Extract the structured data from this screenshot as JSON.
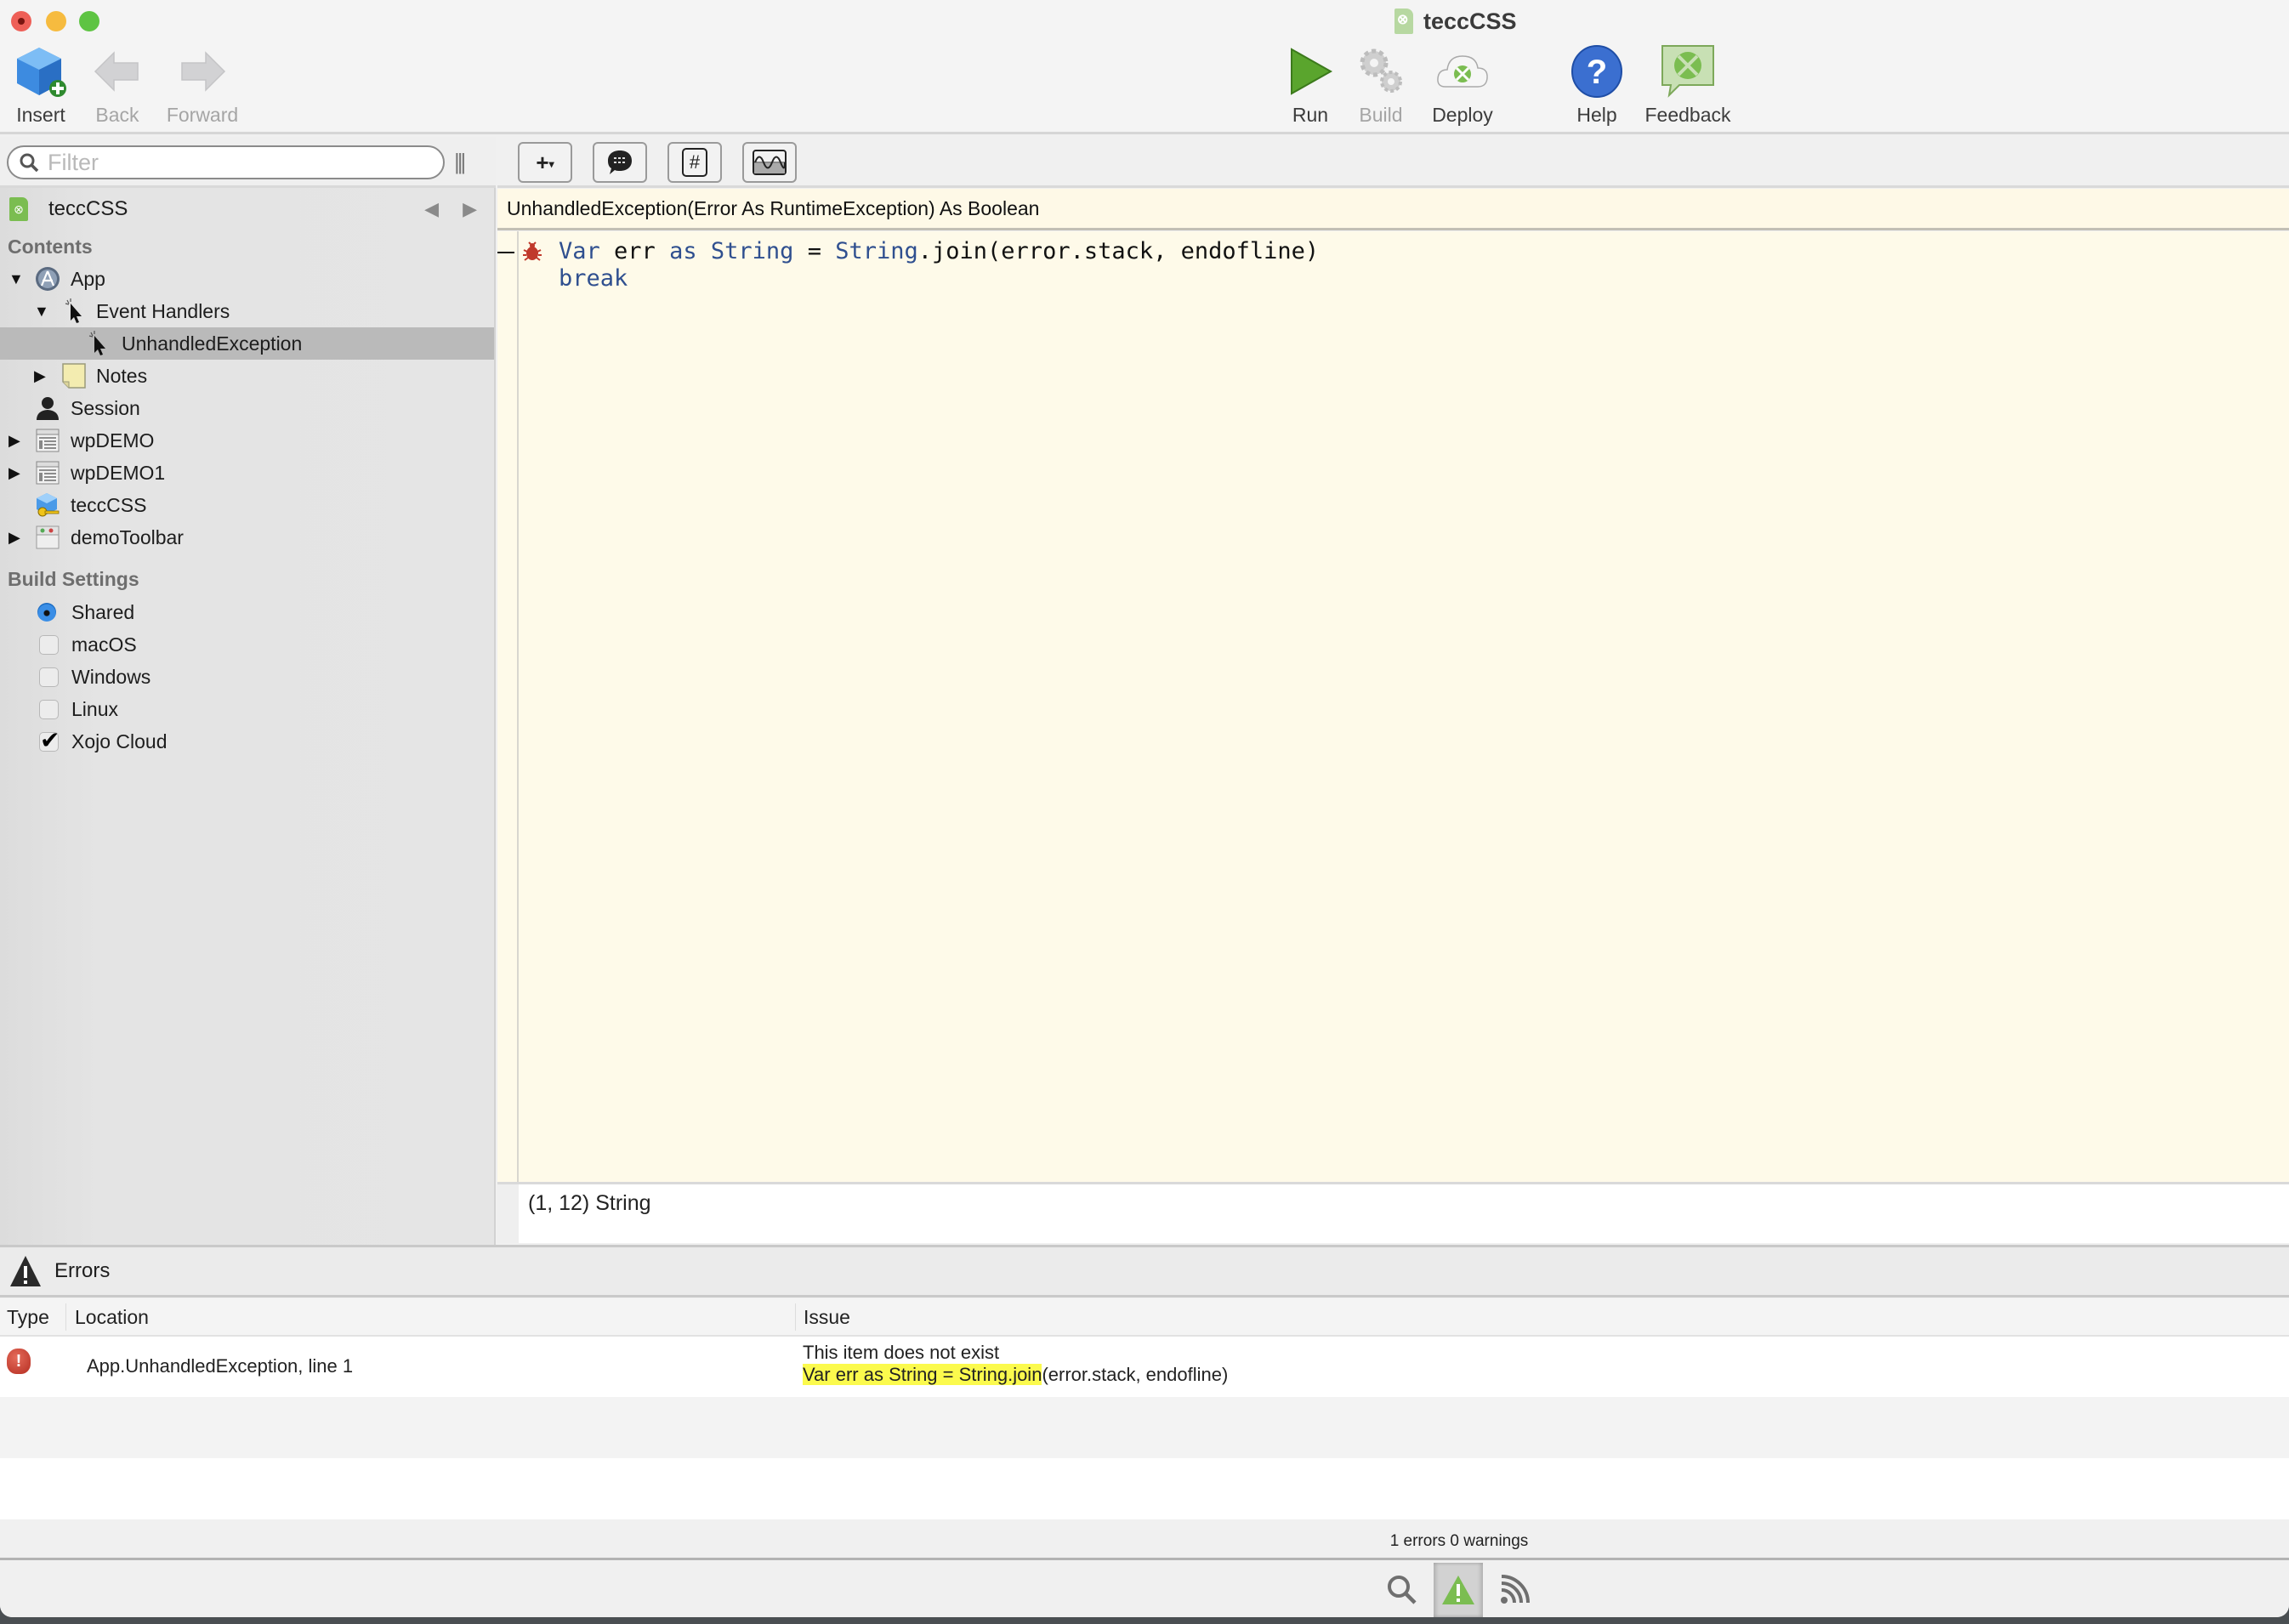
{
  "window": {
    "title": "teccCSS"
  },
  "toolbar": {
    "insert": "Insert",
    "back": "Back",
    "forward": "Forward",
    "run": "Run",
    "build": "Build",
    "deploy": "Deploy",
    "help": "Help",
    "feedback": "Feedback"
  },
  "sidebar": {
    "filter_placeholder": "Filter",
    "project_name": "teccCSS",
    "contents_heading": "Contents",
    "tree": [
      {
        "label": "App",
        "expanded": true,
        "icon": "app-icon"
      },
      {
        "label": "Event Handlers",
        "expanded": true,
        "icon": "event-handler-icon"
      },
      {
        "label": "UnhandledException",
        "selected": true,
        "icon": "event-handler-icon"
      },
      {
        "label": "Notes",
        "expanded": false,
        "icon": "note-icon"
      },
      {
        "label": "Session",
        "icon": "session-icon"
      },
      {
        "label": "wpDEMO",
        "expanded": false,
        "icon": "webpage-icon"
      },
      {
        "label": "wpDEMO1",
        "expanded": false,
        "icon": "webpage-icon"
      },
      {
        "label": "teccCSS",
        "icon": "module-key-icon"
      },
      {
        "label": "demoToolbar",
        "expanded": false,
        "icon": "toolbar-icon"
      }
    ],
    "build_settings_heading": "Build Settings",
    "build_settings": [
      {
        "label": "Shared",
        "type": "radio",
        "checked": true
      },
      {
        "label": "macOS",
        "type": "checkbox",
        "checked": false
      },
      {
        "label": "Windows",
        "type": "checkbox",
        "checked": false
      },
      {
        "label": "Linux",
        "type": "checkbox",
        "checked": false
      },
      {
        "label": "Xojo Cloud",
        "type": "checkbox",
        "checked": true
      }
    ]
  },
  "editor": {
    "toolbar_buttons": [
      "add-menu",
      "comment",
      "pragma",
      "profile"
    ],
    "method_signature": "UnhandledException(Error As RuntimeException) As Boolean",
    "code_lines": [
      "Var err as String = String.join(error.stack, endofline)",
      "break"
    ],
    "info": "(1, 12) String"
  },
  "errors": {
    "panel_title": "Errors",
    "columns": [
      "Type",
      "Location",
      "Issue"
    ],
    "rows": [
      {
        "type": "error",
        "location": "App.UnhandledException, line 1",
        "issue": "This item does not exist",
        "code_highlight": "Var err as String = String.join",
        "code_rest": "(error.stack, endofline)"
      }
    ],
    "summary": "1 errors 0 warnings"
  },
  "colors": {
    "editor_background": "#FEFAE9",
    "keyword": "#2F4F8F",
    "highlight": "#FBFA4D",
    "selection": "#BABABA"
  }
}
